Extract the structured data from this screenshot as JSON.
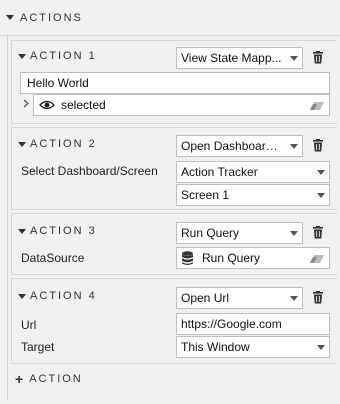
{
  "panel": {
    "title": "ACTIONS"
  },
  "actions": [
    {
      "title": "ACTION 1",
      "type_select": "View State Mapp...",
      "text_value": "Hello World",
      "selected_label": "selected"
    },
    {
      "title": "ACTION 2",
      "type_select": "Open Dashboard...",
      "label": "Select Dashboard/Screen",
      "dashboard_select": "Action Tracker",
      "screen_select": "Screen 1"
    },
    {
      "title": "ACTION 3",
      "type_select": "Run Query",
      "label": "DataSource",
      "datasource_value": "Run Query"
    },
    {
      "title": "ACTION 4",
      "type_select": "Open Url",
      "url_label": "Url",
      "url_value": "https://Google.com",
      "target_label": "Target",
      "target_select": "This Window"
    }
  ],
  "add_action": {
    "label": "ACTION"
  },
  "icons": {
    "collapse": "triangle-down-icon",
    "delete": "trash-icon",
    "expand": "chevron-right-icon",
    "visibility": "eye-icon",
    "clear": "eraser-icon",
    "database": "database-icon",
    "add": "plus-icon"
  }
}
